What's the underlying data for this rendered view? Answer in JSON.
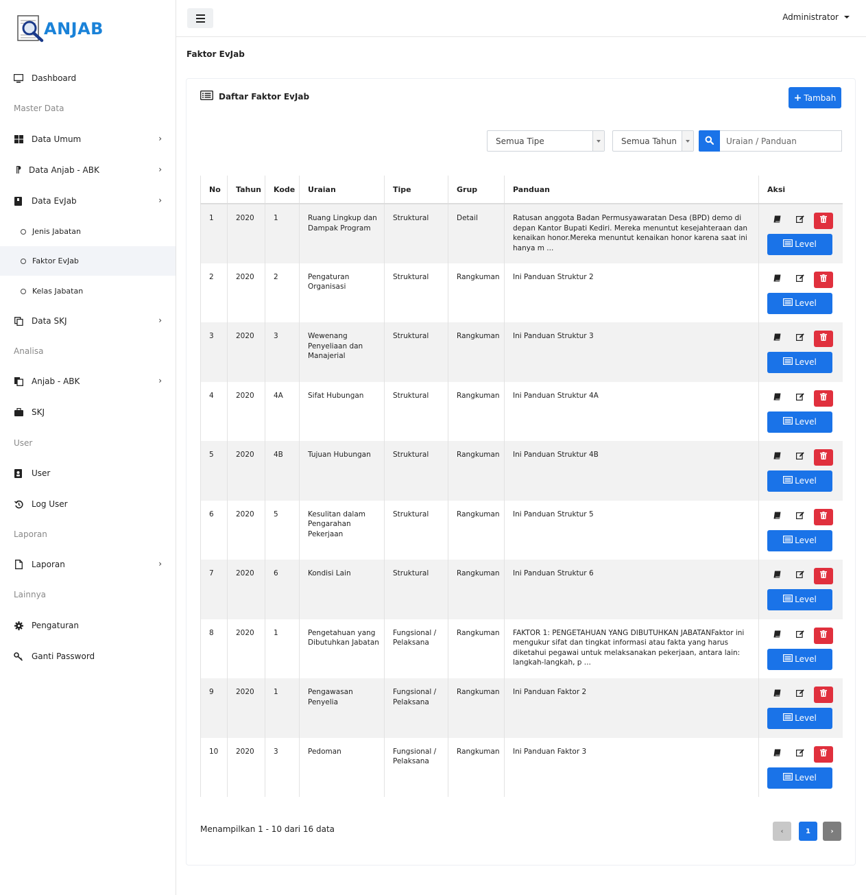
{
  "app": {
    "logo_text": "ANJAB"
  },
  "sidebar": {
    "dashboard": "Dashboard",
    "h_master": "Master Data",
    "data_umum": "Data Umum",
    "data_anjab": "Data Anjab - ABK",
    "data_evjab": "Data EvJab",
    "jenis_jabatan": "Jenis Jabatan",
    "faktor_evjab": "Faktor EvJab",
    "kelas_jabatan": "Kelas Jabatan",
    "data_skj": "Data SKJ",
    "h_analisa": "Analisa",
    "anjab_abk": "Anjab - ABK",
    "skj": "SKJ",
    "h_user": "User",
    "user": "User",
    "log_user": "Log User",
    "h_laporan": "Laporan",
    "laporan": "Laporan",
    "h_lainnya": "Lainnya",
    "pengaturan": "Pengaturan",
    "ganti_password": "Ganti Password"
  },
  "topbar": {
    "user": "Administrator"
  },
  "page": {
    "title": "Faktor EvJab"
  },
  "card": {
    "title": "Daftar Faktor EvJab",
    "add_label": "Tambah",
    "filter_tipe": "Semua Tipe",
    "filter_tahun": "Semua Tahun",
    "search_placeholder": "Uraian / Panduan"
  },
  "table": {
    "headers": [
      "No",
      "Tahun",
      "Kode",
      "Uraian",
      "Tipe",
      "Grup",
      "Panduan",
      "Aksi"
    ],
    "level_label": "Level",
    "rows": [
      {
        "no": "1",
        "tahun": "2020",
        "kode": "1",
        "uraian": "Ruang Lingkup dan Dampak Program",
        "tipe": "Struktural",
        "grup": "Detail",
        "panduan": "Ratusan anggota Badan Permusyawaratan Desa (BPD) demo di depan Kantor Bupati Kediri. Mereka menuntut kesejahteraan dan kenaikan honor.Mereka menuntut kenaikan honor karena saat ini hanya m ..."
      },
      {
        "no": "2",
        "tahun": "2020",
        "kode": "2",
        "uraian": "Pengaturan Organisasi",
        "tipe": "Struktural",
        "grup": "Rangkuman",
        "panduan": "Ini Panduan Struktur 2"
      },
      {
        "no": "3",
        "tahun": "2020",
        "kode": "3",
        "uraian": "Wewenang Penyeliaan dan Manajerial",
        "tipe": "Struktural",
        "grup": "Rangkuman",
        "panduan": "Ini Panduan Struktur 3"
      },
      {
        "no": "4",
        "tahun": "2020",
        "kode": "4A",
        "uraian": "Sifat Hubungan",
        "tipe": "Struktural",
        "grup": "Rangkuman",
        "panduan": "Ini Panduan Struktur 4A"
      },
      {
        "no": "5",
        "tahun": "2020",
        "kode": "4B",
        "uraian": "Tujuan Hubungan",
        "tipe": "Struktural",
        "grup": "Rangkuman",
        "panduan": "Ini Panduan Struktur 4B"
      },
      {
        "no": "6",
        "tahun": "2020",
        "kode": "5",
        "uraian": "Kesulitan dalam Pengarahan Pekerjaan",
        "tipe": "Struktural",
        "grup": "Rangkuman",
        "panduan": "Ini Panduan Struktur 5"
      },
      {
        "no": "7",
        "tahun": "2020",
        "kode": "6",
        "uraian": "Kondisi Lain",
        "tipe": "Struktural",
        "grup": "Rangkuman",
        "panduan": "Ini Panduan Struktur 6"
      },
      {
        "no": "8",
        "tahun": "2020",
        "kode": "1",
        "uraian": "Pengetahuan yang Dibutuhkan Jabatan",
        "tipe": "Fungsional / Pelaksana",
        "grup": "Rangkuman",
        "panduan": "FAKTOR 1: PENGETAHUAN YANG DIBUTUHKAN JABATANFaktor ini mengukur sifat dan tingkat informasi atau fakta yang harus diketahui pegawai untuk melaksanakan pekerjaan, antara lain: langkah-langkah, p ..."
      },
      {
        "no": "9",
        "tahun": "2020",
        "kode": "1",
        "uraian": "Pengawasan Penyelia",
        "tipe": "Fungsional / Pelaksana",
        "grup": "Rangkuman",
        "panduan": "Ini Panduan Faktor 2"
      },
      {
        "no": "10",
        "tahun": "2020",
        "kode": "3",
        "uraian": "Pedoman",
        "tipe": "Fungsional / Pelaksana",
        "grup": "Rangkuman",
        "panduan": "Ini Panduan Faktor 3"
      }
    ]
  },
  "footer": {
    "info": "Menampilkan 1 - 10 dari 16 data",
    "page": "1"
  },
  "colors": {
    "primary": "#1a73e8",
    "danger": "#e0303d",
    "logo": "#1a82d8"
  }
}
